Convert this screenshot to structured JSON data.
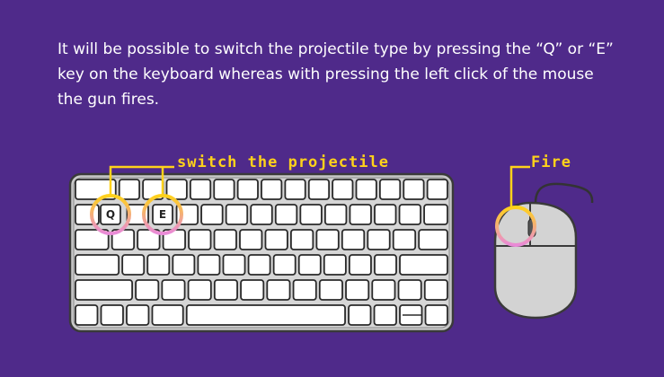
{
  "instructions": "It will be possible to switch the projectile type by pressing the “Q” or “E” key on the keyboard whereas with pressing the left click of the mouse the gun fires.",
  "labels": {
    "switch": "switch the projectile",
    "fire": "Fire"
  },
  "keys": {
    "q": "Q",
    "e": "E"
  },
  "colors": {
    "background": "#4f2a8a",
    "label": "#ffd21a",
    "highlight_top": "#ffd21a",
    "highlight_bottom": "#e98ad8"
  }
}
